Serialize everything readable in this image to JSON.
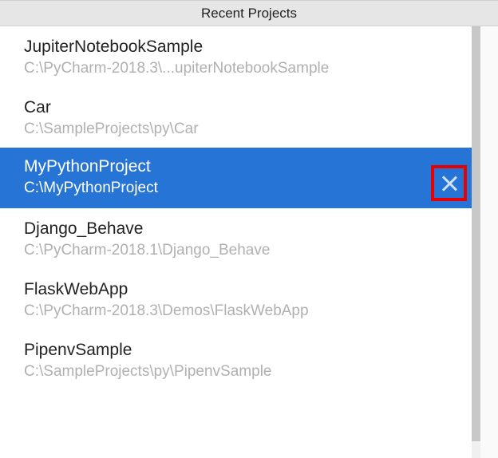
{
  "header": {
    "title": "Recent Projects"
  },
  "projects": [
    {
      "name": "JupiterNotebookSample",
      "path": "C:\\PyCharm-2018.3\\...upiterNotebookSample",
      "selected": false
    },
    {
      "name": "Car",
      "path": "C:\\SampleProjects\\py\\Car",
      "selected": false
    },
    {
      "name": "MyPythonProject",
      "path": "C:\\MyPythonProject",
      "selected": true
    },
    {
      "name": "Django_Behave",
      "path": "C:\\PyCharm-2018.1\\Django_Behave",
      "selected": false
    },
    {
      "name": "FlaskWebApp",
      "path": "C:\\PyCharm-2018.3\\Demos\\FlaskWebApp",
      "selected": false
    },
    {
      "name": "PipenvSample",
      "path": "C:\\SampleProjects\\py\\PipenvSample",
      "selected": false
    }
  ],
  "highlight": {
    "closeAnnotationColor": "#e80000",
    "selectedBg": "#2675d6"
  }
}
